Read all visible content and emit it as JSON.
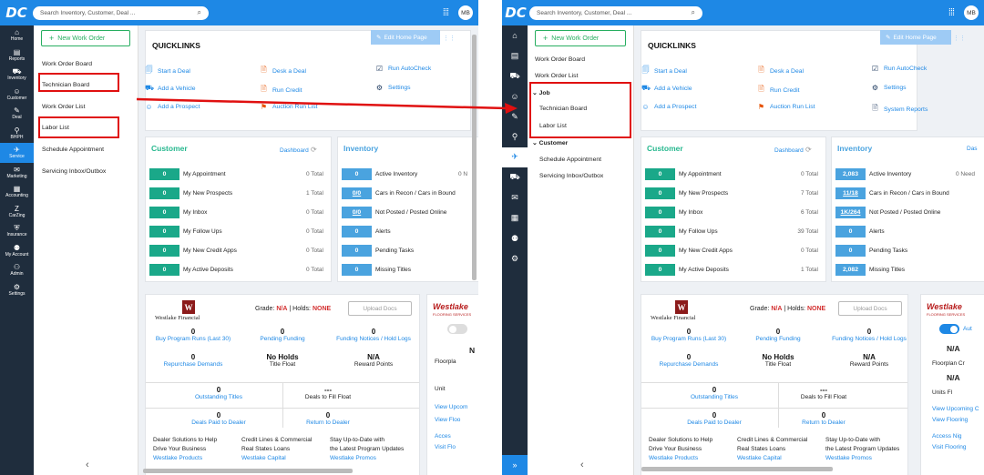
{
  "app": {
    "logo": "DC",
    "search_placeholder": "Search Inventory, Customer, Deal ...",
    "user_initials": "MB"
  },
  "left_sidebar": [
    {
      "label": "Home",
      "icon": "⌂"
    },
    {
      "label": "Reports",
      "icon": "▤"
    },
    {
      "label": "Inventory",
      "icon": "⛟"
    },
    {
      "label": "Customer",
      "icon": "☺"
    },
    {
      "label": "Deal",
      "icon": "✎"
    },
    {
      "label": "BHPH",
      "icon": "⚲"
    },
    {
      "label": "Service",
      "icon": "✈"
    },
    {
      "label": "Marketing",
      "icon": "✉"
    },
    {
      "label": "Accounting",
      "icon": "▦"
    },
    {
      "label": "CarZing",
      "icon": "Z"
    },
    {
      "label": "Insurance",
      "icon": "⛨"
    },
    {
      "label": "My Account",
      "icon": "⚉"
    },
    {
      "label": "Admin",
      "icon": "⚇"
    },
    {
      "label": "Settings",
      "icon": "⚙"
    }
  ],
  "right_sidebar_icons": [
    "⌂",
    "▤",
    "⛟",
    "☺",
    "✎",
    "⚲",
    "✈",
    "⛟",
    "✉",
    "▦",
    "⚉",
    "⚙"
  ],
  "subnav": {
    "new_work_order": "New Work Order",
    "left_items": [
      "Work Order Board",
      "Technician Board",
      "Work Order List",
      "Labor List",
      "Schedule Appointment",
      "Servicing Inbox/Outbox"
    ],
    "right_items": {
      "work_order_board": "Work Order Board",
      "work_order_list": "Work Order List",
      "job_group": "Job",
      "technician_board": "Technician Board",
      "labor_list": "Labor List",
      "customer_group": "Customer",
      "schedule_appointment": "Schedule Appointment",
      "servicing_inbox": "Servicing Inbox/Outbox"
    }
  },
  "quicklinks": {
    "title": "QUICKLINKS",
    "edit_home_page": "Edit Home Page",
    "col1": [
      "Start a Deal",
      "Add a Vehicle",
      "Add a Prospect"
    ],
    "col2": [
      "Desk a Deal",
      "Run Credit",
      "Auction Run List"
    ],
    "col3": [
      "Run AutoCheck",
      "Settings",
      "System Reports"
    ],
    "icons1": [
      "🗐",
      "⛟",
      "☺"
    ],
    "icons2": [
      "🗎",
      "🗎",
      "⚑"
    ],
    "icons3": [
      "☑",
      "⚙",
      "🗎"
    ]
  },
  "customer": {
    "title": "Customer",
    "dashboard": "Dashboard",
    "total_suffix": "Total",
    "rows": [
      "My Appointment",
      "My New Prospects",
      "My Inbox",
      "My Follow Ups",
      "My New Credit Apps",
      "My Active Deposits"
    ],
    "left_values": [
      "0",
      "0",
      "0",
      "0",
      "0",
      "0"
    ],
    "left_totals": [
      "0",
      "1",
      "0",
      "0",
      "0",
      "0"
    ],
    "right_values": [
      "0",
      "0",
      "0",
      "0",
      "0",
      "0"
    ],
    "right_totals": [
      "0",
      "7",
      "6",
      "39",
      "0",
      "1"
    ]
  },
  "inventory": {
    "title": "Inventory",
    "dashboard_partial": "Das",
    "rows": [
      "Active Inventory",
      "Cars in Recon / Cars in Bound",
      "Not Posted / Posted Online",
      "Alerts",
      "Pending Tasks",
      "Missing Titles"
    ],
    "left_values": [
      "0",
      "0/0",
      "0/0",
      "0",
      "0",
      "0"
    ],
    "right_values": [
      "2,083",
      "11/18",
      "1K/264",
      "0",
      "0",
      "2,082"
    ],
    "left_extra": "0 N",
    "right_extra": "0 Need"
  },
  "westlake": {
    "brand": "Westlake Financial",
    "grade_label": "Grade:",
    "grade": "N/A",
    "holds_label": "Holds:",
    "holds": "NONE",
    "upload": "Upload Docs",
    "r1": [
      {
        "v": "0",
        "l": "Buy Program Runs (Last 30)"
      },
      {
        "v": "0",
        "l": "Pending Funding"
      },
      {
        "v": "0",
        "l": "Funding Notices / Hold Logs"
      }
    ],
    "r2": [
      {
        "v": "0",
        "l": "Repurchase Demands"
      },
      {
        "v": "No Holds",
        "l": "Title Float"
      },
      {
        "v": "N/A",
        "l": "Reward Points"
      }
    ],
    "r3": [
      {
        "v": "0",
        "l": "Outstanding Titles"
      },
      {
        "v": "---",
        "l": "Deals to Fill Float"
      }
    ],
    "r4": [
      {
        "v": "0",
        "l": "Deals Paid to Dealer"
      },
      {
        "v": "0",
        "l": "Return to Dealer"
      }
    ],
    "promo": [
      [
        "Dealer Solutions to Help",
        "Drive Your Business",
        "Westlake Products"
      ],
      [
        "Credit Lines & Commercial",
        "Real States Loans",
        "Westlake Capital"
      ],
      [
        "Stay Up-to-Date with",
        "the Latest Program Updates",
        "Westlake Promos"
      ]
    ]
  },
  "flooring": {
    "brand": "Westlake",
    "sub": "FLOORING SERVICES",
    "toggle_label_right": "Aut",
    "left_items": [
      "N",
      "Floorpla",
      "Unit",
      "View Upcom",
      "View Floo",
      "Acces",
      "Visit Flo"
    ],
    "right_items": [
      "N/A",
      "Floorplan Cr",
      "N/A",
      "Units Fl",
      "View Upcoming C",
      "View Flooring",
      "Access Nig",
      "Visit Flooring"
    ]
  }
}
